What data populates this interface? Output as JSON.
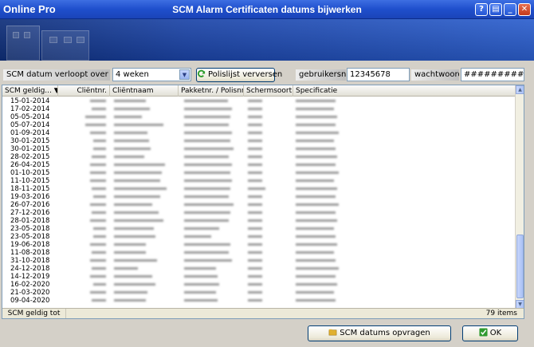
{
  "window": {
    "logo": "Online Pro",
    "title": "SCM Alarm Certificaten datums bijwerken"
  },
  "toolbar": {
    "expiry_label": "SCM datum verloopt over",
    "expiry_value": "4 weken",
    "refresh_button": "Polislijst verversen",
    "username_label": "gebruikersnaam",
    "username_value": "12345678",
    "password_label": "wachtwoord",
    "password_value": "############"
  },
  "grid": {
    "columns": [
      "SCM geldig...",
      "Cliëntnr.",
      "Cliëntnaam",
      "Pakketnr. / Polisnr.",
      "Schermsoort",
      "Specificatie"
    ],
    "dates": [
      "15-01-2014",
      "17-02-2014",
      "05-05-2014",
      "05-07-2014",
      "01-09-2014",
      "30-01-2015",
      "30-01-2015",
      "28-02-2015",
      "26-04-2015",
      "01-10-2015",
      "11-10-2015",
      "18-11-2015",
      "19-03-2016",
      "26-07-2016",
      "27-12-2016",
      "28-01-2018",
      "23-05-2018",
      "23-05-2018",
      "19-06-2018",
      "11-08-2018",
      "31-10-2018",
      "24-12-2018",
      "14-12-2019",
      "16-02-2020",
      "21-03-2020",
      "09-04-2020"
    ],
    "footer_label": "SCM geldig tot",
    "item_count": "79 items"
  },
  "actions": {
    "fetch_button": "SCM datums opvragen",
    "ok_button": "OK"
  }
}
